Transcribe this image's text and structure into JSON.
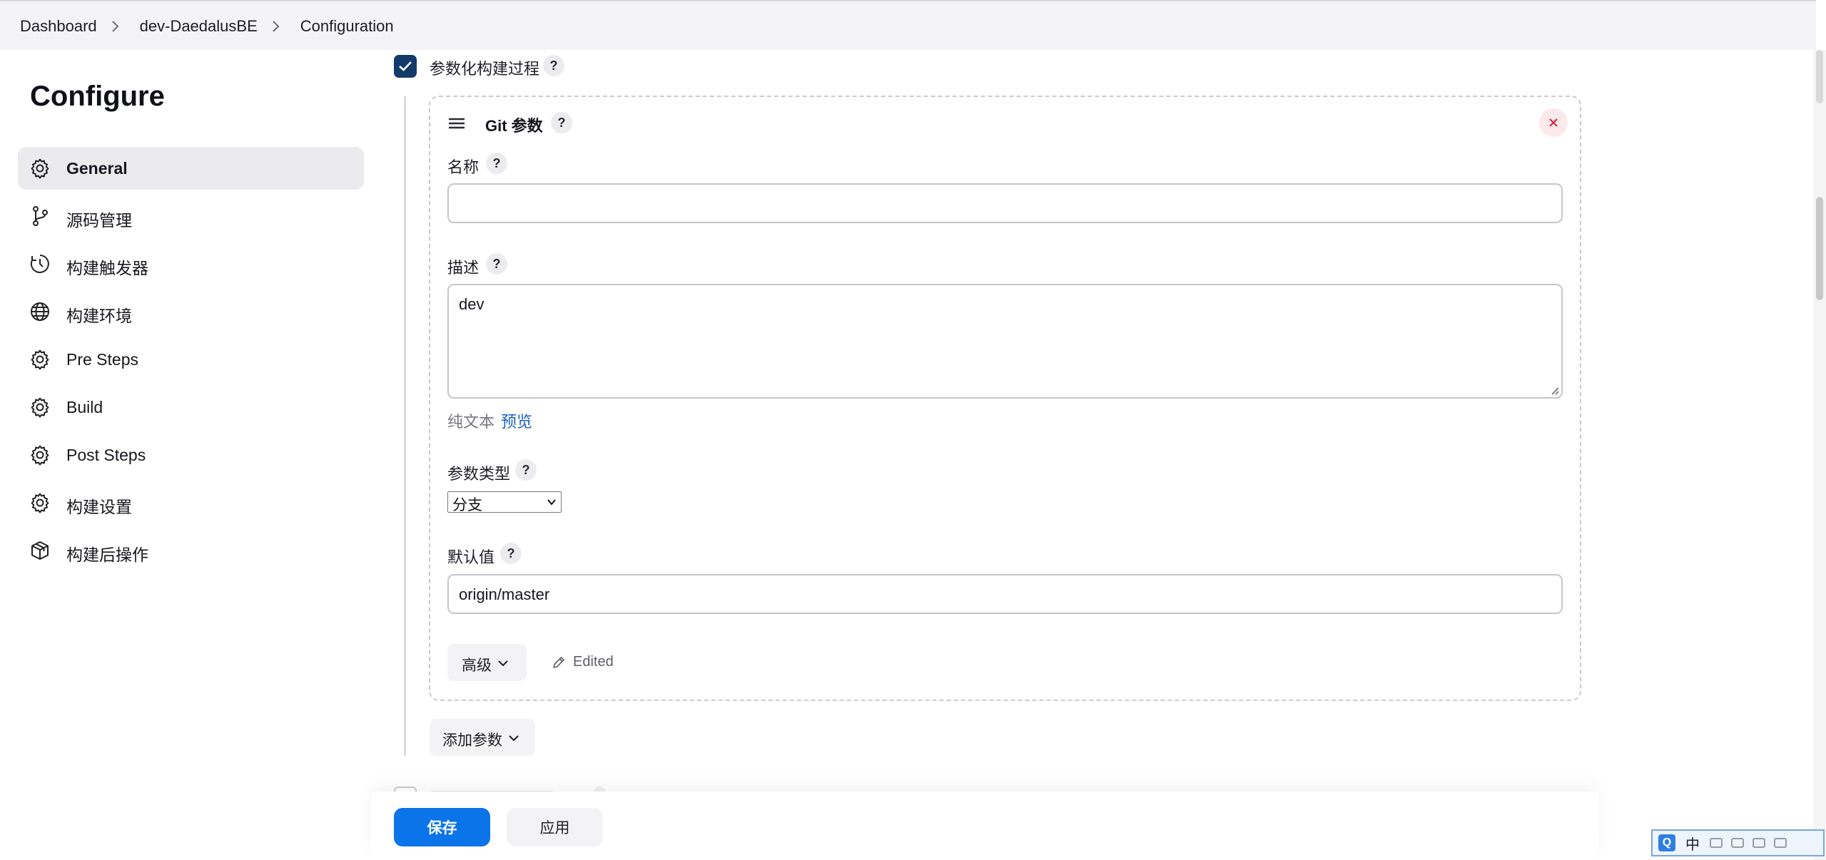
{
  "breadcrumb": [
    "Dashboard",
    "dev-DaedalusBE",
    "Configuration"
  ],
  "page": {
    "title": "Configure"
  },
  "sidebar": {
    "items": [
      {
        "label": "General",
        "icon": "gear-icon",
        "active": true
      },
      {
        "label": "源码管理",
        "icon": "branch-icon",
        "active": false
      },
      {
        "label": "构建触发器",
        "icon": "clock-icon",
        "active": false
      },
      {
        "label": "构建环境",
        "icon": "globe-icon",
        "active": false
      },
      {
        "label": "Pre Steps",
        "icon": "gear-icon",
        "active": false
      },
      {
        "label": "Build",
        "icon": "gear-icon",
        "active": false
      },
      {
        "label": "Post Steps",
        "icon": "gear-icon",
        "active": false
      },
      {
        "label": "构建设置",
        "icon": "gear-icon",
        "active": false
      },
      {
        "label": "构建后操作",
        "icon": "package-icon",
        "active": false
      }
    ]
  },
  "form": {
    "parameterized": {
      "label": "参数化构建过程",
      "checked": true,
      "help": "?"
    },
    "card": {
      "title": "Git 参数",
      "help": "?",
      "name_label": "名称",
      "name_value": "",
      "desc_label": "描述",
      "desc_value": "dev",
      "plain_text": "纯文本",
      "preview": "预览",
      "type_label": "参数类型",
      "type_value": "分支",
      "default_label": "默认值",
      "default_value": "origin/master",
      "advanced": "高级",
      "edited": "Edited"
    },
    "add_param": "添加参数"
  },
  "actions": {
    "save": "保存",
    "apply": "应用"
  },
  "ime": {
    "q": "Q",
    "lang": "中"
  },
  "colors": {
    "primary": "#0b74e8",
    "checkbox": "#123b69",
    "link": "#1a60c4",
    "close": "#d3203a"
  }
}
